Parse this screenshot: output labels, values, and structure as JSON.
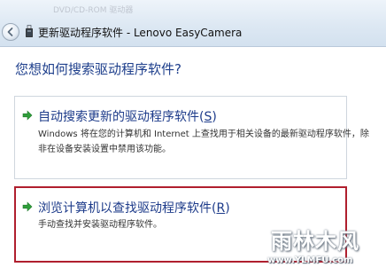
{
  "window": {
    "title": "更新驱动程序软件 - Lenovo EasyCamera",
    "background_ghost_text": "DVD/CD-ROM 驱动器"
  },
  "main": {
    "heading": "您想如何搜索驱动程序软件?"
  },
  "options": [
    {
      "title_text": "自动搜索更新的驱动程序软件",
      "title_accel": "S",
      "description_lines": [
        "Windows 将在您的计算机和 Internet 上查找用于相关设备的最新驱动程序软件，除",
        "非在设备安装设置中禁用该功能。"
      ]
    },
    {
      "title_text": "浏览计算机以查找驱动程序软件",
      "title_accel": "R",
      "description_lines": [
        "手动查找并安装驱动程序软件。"
      ]
    }
  ],
  "watermark": {
    "main_text": "雨林木风",
    "sub_text": "www.YLMFU.com"
  },
  "colors": {
    "heading": "#1e3f8c",
    "option_title": "#1d3b8a",
    "arrow": "#2f9e3a",
    "highlight_border": "#b01f2e"
  },
  "icons": {
    "back": "back-arrow-icon",
    "device": "usb-device-icon",
    "option_arrow": "green-arrow-icon"
  }
}
